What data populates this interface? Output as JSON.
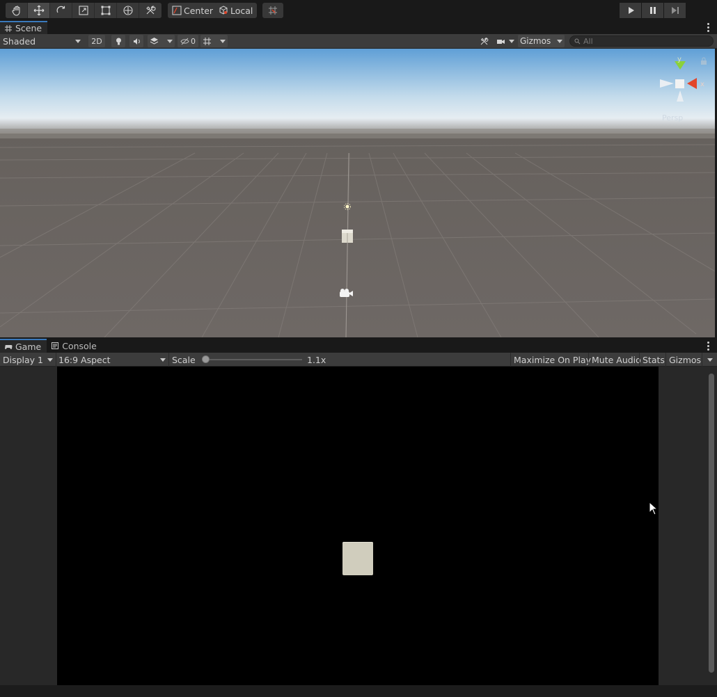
{
  "toolbar": {
    "tools": [
      {
        "name": "hand-tool",
        "icon": "hand-icon"
      },
      {
        "name": "move-tool",
        "icon": "move-icon",
        "active": true
      },
      {
        "name": "rotate-tool",
        "icon": "rotate-icon"
      },
      {
        "name": "scale-tool",
        "icon": "scale-icon"
      },
      {
        "name": "rect-tool",
        "icon": "rect-transform-icon"
      },
      {
        "name": "transform-tool",
        "icon": "transform-icon"
      },
      {
        "name": "custom-tool",
        "icon": "custom-tools-icon"
      }
    ],
    "pivot_label": "Center",
    "space_label": "Local",
    "snap_icon": "grid-snap-icon",
    "play_icon": "play-icon",
    "pause_icon": "pause-icon",
    "step_icon": "step-icon"
  },
  "scene": {
    "tab_label": "Scene",
    "tab_icon": "hash-grid-icon",
    "shading_mode": "Shaded",
    "mode_2d_label": "2D",
    "hidden_count": "0",
    "gizmos_label": "Gizmos",
    "search_placeholder": "All",
    "persp_label": "Persp",
    "axis_labels": {
      "y": "y",
      "x": "x"
    },
    "colors": {
      "sky_top": "#5f9fd6",
      "horizon": "#e6edf2",
      "ground": "#6b6663",
      "axis_y": "#8bd13a",
      "axis_x": "#e2452a"
    }
  },
  "game": {
    "tab_label": "Game",
    "tab_icon": "gamepad-icon",
    "console_tab_label": "Console",
    "console_icon": "console-icon",
    "display_label": "Display 1",
    "aspect_label": "16:9 Aspect",
    "scale_label": "Scale",
    "scale_value": "1.1x",
    "scale_fraction": 0.02,
    "maximize_label": "Maximize On Play",
    "mute_label": "Mute Audio",
    "stats_label": "Stats",
    "gizmos_label": "Gizmos",
    "accent": "#3a79bb"
  }
}
